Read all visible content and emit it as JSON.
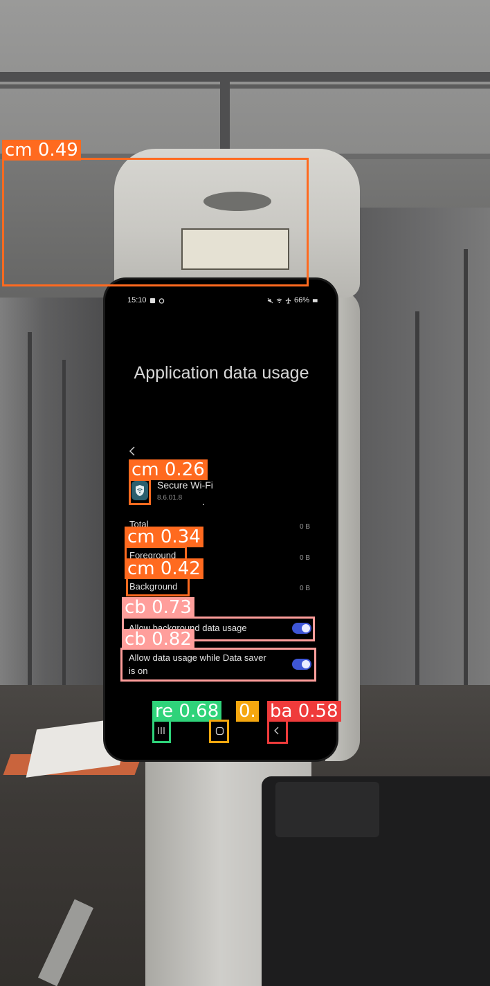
{
  "status_bar": {
    "time": "15:10",
    "battery": "66%"
  },
  "screen": {
    "title": "Application data usage",
    "app_name": "Secure Wi-Fi",
    "app_version": "8.6.01.8",
    "rows": [
      {
        "label": "Total",
        "value": "0 B"
      },
      {
        "label": "Foreground",
        "value": "0 B"
      },
      {
        "label": "Background",
        "value": "0 B"
      }
    ],
    "toggles": [
      {
        "label": "Allow background data usage",
        "on": true
      },
      {
        "label": "Allow data usage while Data saver is on",
        "on": true
      }
    ]
  },
  "navbar": {
    "recents_icon": "recents-icon",
    "home_icon": "home-icon",
    "back_icon": "back-icon"
  },
  "detections": [
    {
      "label": "cm 0.49",
      "color": "#ff6a1f"
    },
    {
      "label": "cm 0.26",
      "color": "#ff6a1f"
    },
    {
      "label": "cm 0.34",
      "color": "#ff6a1f"
    },
    {
      "label": "cm 0.42",
      "color": "#ff6a1f"
    },
    {
      "label": "cb 0.73",
      "color": "#ff9e9b"
    },
    {
      "label": "cb 0.82",
      "color": "#ff9e9b"
    },
    {
      "label": "re 0.68",
      "color": "#2fd37a"
    },
    {
      "label": "0.",
      "color": "#f5a70f"
    },
    {
      "label": "ba 0.58",
      "color": "#ef3b3b"
    }
  ]
}
